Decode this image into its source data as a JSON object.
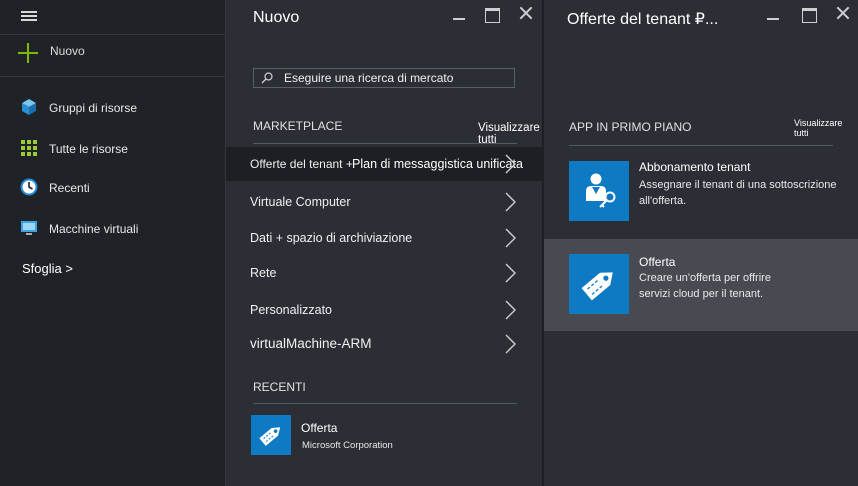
{
  "nav": {
    "new_label": "Nuovo",
    "items": [
      {
        "label": "Gruppi di risorse",
        "icon": "cube-icon"
      },
      {
        "label": "Tutte le risorse",
        "icon": "grid-icon"
      },
      {
        "label": "Recenti",
        "icon": "clock-icon"
      },
      {
        "label": "Macchine virtuali",
        "icon": "monitor-icon"
      }
    ],
    "browse_label": "Sfoglia >"
  },
  "new_blade": {
    "title": "Nuovo",
    "search_placeholder": "Eseguire una ricerca di mercato",
    "marketplace_label": "MARKETPLACE",
    "see_all": "Visualizzare tutti",
    "items": [
      {
        "label": "Offerte del tenant +"
      },
      {
        "label": "Virtuale Computer"
      },
      {
        "label": "Dati + spazio di archiviazione"
      },
      {
        "label": "Rete"
      },
      {
        "label": "Personalizzato"
      },
      {
        "label": "virtualMachine-ARM"
      }
    ],
    "tooltip": "Plan di messaggistica unificata",
    "recent_label": "RECENTI",
    "recent": {
      "title": "Offerta",
      "publisher": "Microsoft Corporation",
      "icon": "tag-icon"
    }
  },
  "offers_blade": {
    "title": "Offerte del tenant ₽...",
    "featured_label": "APP IN PRIMO PIANO",
    "see_all": "Visualizzare tutti",
    "items": [
      {
        "title": "Abbonamento tenant",
        "desc1": "Assegnare il tenant di una sottoscrizione",
        "desc2": "all'offerta.",
        "icon": "user-key-icon"
      },
      {
        "title": "Offerta",
        "desc1": "Creare un'offerta per offrire",
        "desc2": "servizi cloud per il tenant.",
        "icon": "tag-icon"
      }
    ]
  },
  "colors": {
    "accent": "#0e7ac4",
    "new_plus": "#7fba00",
    "selected_bg": "#474b51"
  }
}
